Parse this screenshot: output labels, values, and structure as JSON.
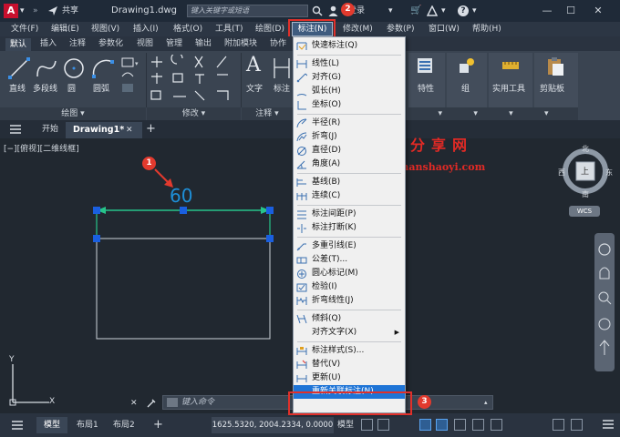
{
  "titlebar": {
    "share": "共享",
    "filename": "Drawing1.dwg",
    "search_placeholder": "键入关键字或短语",
    "login": "登录"
  },
  "menubar": {
    "items": [
      "文件(F)",
      "编辑(E)",
      "视图(V)",
      "插入(I)",
      "格式(O)",
      "工具(T)",
      "绘图(D)",
      "标注(N)",
      "修改(M)",
      "参数(P)",
      "窗口(W)",
      "帮助(H)"
    ]
  },
  "ribbon_tabs": [
    "默认",
    "插入",
    "注释",
    "参数化",
    "视图",
    "管理",
    "输出",
    "附加模块",
    "协作"
  ],
  "ribbon": {
    "draw_tools": [
      "直线",
      "多段线",
      "圆",
      "圆弧"
    ],
    "draw_panel": "绘图",
    "modify_panel": "修改",
    "annot_tools": [
      "文字",
      "标注"
    ],
    "annot_panel": "注释",
    "right_tools": [
      "特性",
      "组",
      "实用工具",
      "剪贴板"
    ]
  },
  "doc_tabs": {
    "start": "开始",
    "drawing": "Drawing1*"
  },
  "viewport_label": "[−][俯视][二维线框]",
  "drawing": {
    "dimension_text": "60"
  },
  "viewcube": {
    "north": "北",
    "south": "南",
    "west": "西",
    "east": "东",
    "top": "上",
    "wcs": "WCS"
  },
  "ucs": {
    "y": "Y",
    "x": "X"
  },
  "cmdline": {
    "placeholder": "键入命令"
  },
  "statusbar": {
    "model_tab": "模型",
    "layouts": [
      "布局1",
      "布局2"
    ],
    "coords": "1625.5320, 2004.2334, 0.0000",
    "model_mode": "模型"
  },
  "dropdown": {
    "items": [
      {
        "label": "快速标注(Q)",
        "icon": "quick-dim-icon"
      },
      {
        "sep": true
      },
      {
        "label": "线性(L)",
        "icon": "linear-dim-icon"
      },
      {
        "label": "对齐(G)",
        "icon": "aligned-dim-icon"
      },
      {
        "label": "弧长(H)",
        "icon": "arc-length-icon"
      },
      {
        "label": "坐标(O)",
        "icon": "ordinate-icon"
      },
      {
        "sep": true
      },
      {
        "label": "半径(R)",
        "icon": "radius-icon"
      },
      {
        "label": "折弯(J)",
        "icon": "jogged-icon"
      },
      {
        "label": "直径(D)",
        "icon": "diameter-icon"
      },
      {
        "label": "角度(A)",
        "icon": "angular-icon"
      },
      {
        "sep": true
      },
      {
        "label": "基线(B)",
        "icon": "baseline-icon"
      },
      {
        "label": "连续(C)",
        "icon": "continue-icon"
      },
      {
        "sep": true
      },
      {
        "label": "标注间距(P)",
        "icon": "dim-space-icon"
      },
      {
        "label": "标注打断(K)",
        "icon": "dim-break-icon"
      },
      {
        "sep": true
      },
      {
        "label": "多重引线(E)",
        "icon": "mleader-icon"
      },
      {
        "label": "公差(T)...",
        "icon": "tolerance-icon"
      },
      {
        "label": "圆心标记(M)",
        "icon": "center-mark-icon"
      },
      {
        "label": "检验(I)",
        "icon": "inspect-icon"
      },
      {
        "label": "折弯线性(J)",
        "icon": "jogged-linear-icon"
      },
      {
        "sep": true
      },
      {
        "label": "倾斜(Q)",
        "icon": "oblique-icon"
      },
      {
        "label": "对齐文字(X)",
        "icon": "",
        "submenu": true
      },
      {
        "sep": true
      },
      {
        "label": "标注样式(S)...",
        "icon": "dim-style-icon"
      },
      {
        "label": "替代(V)",
        "icon": "override-icon"
      },
      {
        "label": "更新(U)",
        "icon": "update-icon"
      },
      {
        "label": "重新关联标注(N)",
        "icon": "reassociate-icon",
        "highlighted": true
      }
    ]
  },
  "annotations": {
    "badge1": "1",
    "badge2": "2",
    "badge3": "3"
  },
  "watermark": {
    "line1": "我爱分享网",
    "line2": "www.zhanshaoyi.com"
  },
  "colors": {
    "accent": "#1e74d6",
    "callout_red": "#e0302a",
    "dimension_green": "#27c48a",
    "grip_blue": "#1a5fe0"
  }
}
